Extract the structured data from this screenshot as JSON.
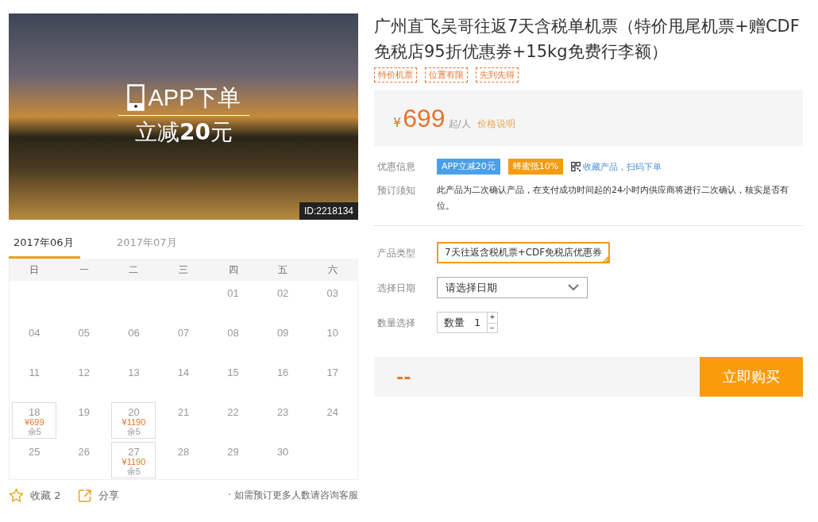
{
  "banner": {
    "headline": "APP下单",
    "subline": "立减**20**元",
    "id_label": "ID:2218134"
  },
  "calendar": {
    "tabs": [
      {
        "label": "2017年06月",
        "selected": true
      },
      {
        "label": "2017年07月",
        "selected": false
      }
    ],
    "weekdays": [
      "日",
      "一",
      "二",
      "三",
      "四",
      "五",
      "六"
    ],
    "weeks": [
      [
        {
          "kind": "empty"
        },
        {
          "kind": "empty"
        },
        {
          "kind": "empty"
        },
        {
          "kind": "empty"
        },
        {
          "kind": "date",
          "day": "01"
        },
        {
          "kind": "date",
          "day": "02"
        },
        {
          "kind": "date",
          "day": "03"
        }
      ],
      [
        {
          "kind": "date",
          "day": "04"
        },
        {
          "kind": "date",
          "day": "05"
        },
        {
          "kind": "date",
          "day": "06"
        },
        {
          "kind": "date",
          "day": "07"
        },
        {
          "kind": "date",
          "day": "08"
        },
        {
          "kind": "date",
          "day": "09"
        },
        {
          "kind": "date",
          "day": "10"
        }
      ],
      [
        {
          "kind": "date",
          "day": "11"
        },
        {
          "kind": "date",
          "day": "12"
        },
        {
          "kind": "date",
          "day": "13"
        },
        {
          "kind": "date",
          "day": "14"
        },
        {
          "kind": "date",
          "day": "15"
        },
        {
          "kind": "date",
          "day": "16"
        },
        {
          "kind": "date",
          "day": "17"
        }
      ],
      [
        {
          "kind": "bookable",
          "day": "18",
          "price": "¥699",
          "stock": "余5"
        },
        {
          "kind": "date",
          "day": "19"
        },
        {
          "kind": "bookable",
          "day": "20",
          "price": "¥1190",
          "stock": "余5"
        },
        {
          "kind": "date",
          "day": "21"
        },
        {
          "kind": "date",
          "day": "22"
        },
        {
          "kind": "date",
          "day": "23"
        },
        {
          "kind": "date",
          "day": "24"
        }
      ],
      [
        {
          "kind": "date",
          "day": "25"
        },
        {
          "kind": "date",
          "day": "26"
        },
        {
          "kind": "bookable",
          "day": "27",
          "price": "¥1190",
          "stock": "余5"
        },
        {
          "kind": "date",
          "day": "28"
        },
        {
          "kind": "date",
          "day": "29"
        },
        {
          "kind": "date",
          "day": "30"
        },
        {
          "kind": "empty"
        }
      ]
    ]
  },
  "footer": {
    "favorite": "收藏 2",
    "share": "分享",
    "note": "· 如需预订更多人数请咨询客服"
  },
  "product": {
    "title": "广州直飞吴哥往返7天含税单机票（特价甩尾机票+赠CDF免税店95折优惠券+15kg免费行李额）",
    "tags": [
      "特价机票",
      "位置有限",
      "先到先得"
    ],
    "price": {
      "currency": "¥",
      "amount": "699",
      "unit": "起/人",
      "link": "价格说明"
    },
    "promo": {
      "label": "优惠信息",
      "badges": [
        {
          "text": "APP立减20元",
          "color": "#4a9fe8"
        },
        {
          "text": "蜂蜜抵10%",
          "color": "#f39c12"
        }
      ],
      "link": "收藏产品，扫码下单"
    },
    "notice": {
      "label": "预订须知",
      "text": "此产品为二次确认产品，在支付成功时间起的24小时内供应商将进行二次确认，核实是否有位。"
    },
    "type": {
      "label": "产品类型",
      "options": [
        {
          "text": "7天往返含税机票+CDF免税店优惠券",
          "selected": true
        }
      ]
    },
    "date": {
      "label": "选择日期",
      "placeholder": "请选择日期"
    },
    "quantity": {
      "label": "数量选择",
      "prefix": "数量",
      "value": "1",
      "plus": "+",
      "minus": "−"
    },
    "total": "--",
    "buy": "立即购买"
  }
}
